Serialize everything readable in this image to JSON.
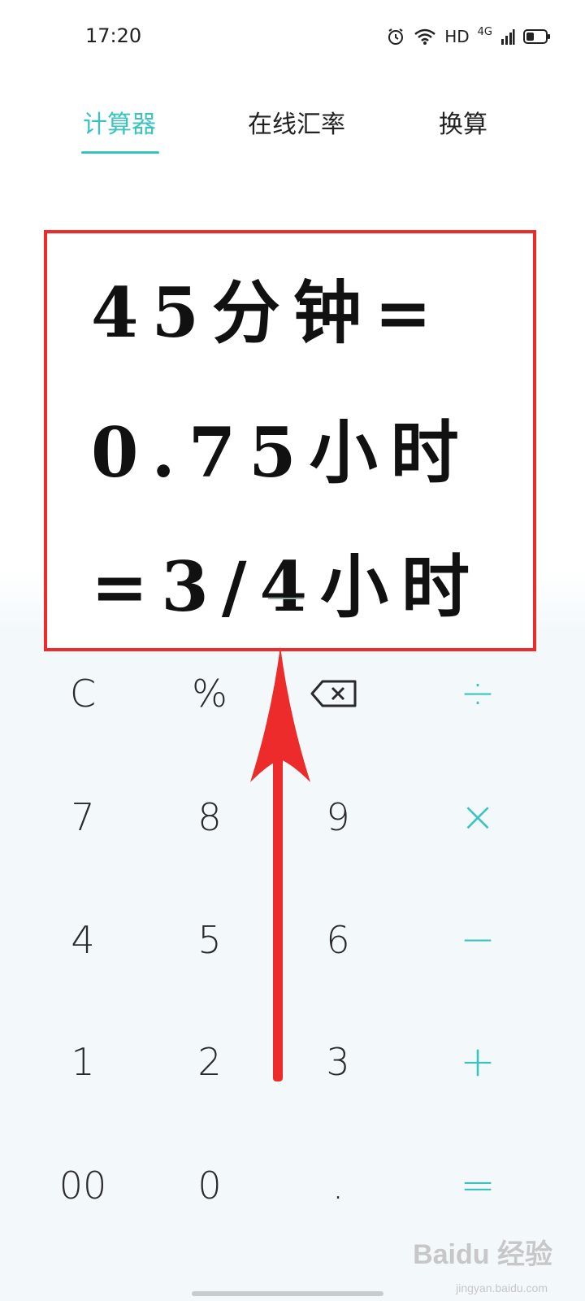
{
  "status_bar": {
    "time": "17:20",
    "hd": "HD",
    "network": "4G"
  },
  "tabs": [
    {
      "label": "计算器",
      "active": true
    },
    {
      "label": "在线汇率",
      "active": false
    },
    {
      "label": "换算",
      "active": false
    }
  ],
  "overlay": {
    "lines": [
      "45分钟=",
      "0.75小时",
      "=3/4小时"
    ]
  },
  "keypad": {
    "rows": [
      [
        "C",
        "%",
        "⌫",
        "÷"
      ],
      [
        "7",
        "8",
        "9",
        "×"
      ],
      [
        "4",
        "5",
        "6",
        "−"
      ],
      [
        "1",
        "2",
        "3",
        "+"
      ],
      [
        "00",
        "0",
        ".",
        "="
      ]
    ]
  },
  "watermark": {
    "brand": "Baidu 经验",
    "url": "jingyan.baidu.com"
  },
  "colors": {
    "accent": "#3cc3c0",
    "annotation_red": "#ee2b2b"
  }
}
